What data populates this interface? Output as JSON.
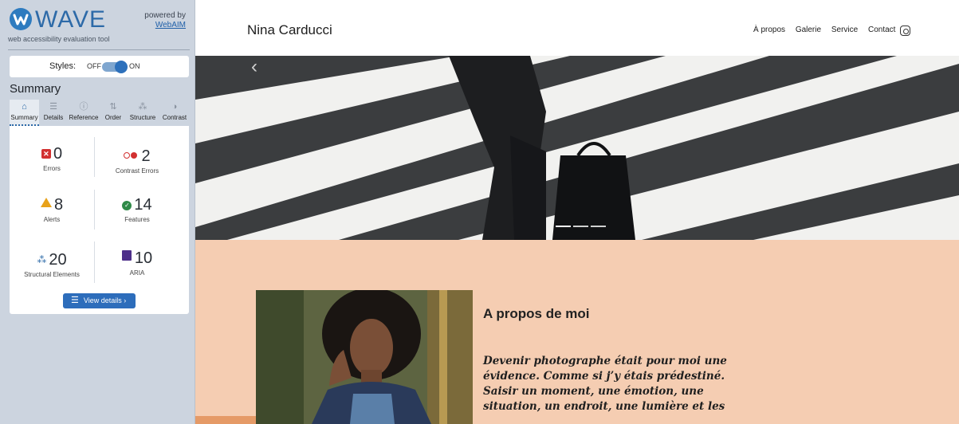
{
  "wave": {
    "logo_text": "WAVE",
    "subtitle": "web accessibility evaluation tool",
    "powered_by": "powered by",
    "webaim_link": "WebAIM",
    "styles": {
      "label": "Styles:",
      "off": "OFF",
      "on": "ON",
      "state": "on"
    },
    "summary_title": "Summary",
    "tabs": [
      {
        "label": "Summary",
        "icon": "home-icon",
        "glyph": "⌂"
      },
      {
        "label": "Details",
        "icon": "list-icon",
        "glyph": "☰"
      },
      {
        "label": "Reference",
        "icon": "info-icon",
        "glyph": "ⓘ"
      },
      {
        "label": "Order",
        "icon": "order-icon",
        "glyph": "⇅"
      },
      {
        "label": "Structure",
        "icon": "structure-icon",
        "glyph": "⁂"
      },
      {
        "label": "Contrast",
        "icon": "contrast-icon",
        "glyph": "◑"
      }
    ],
    "stats": {
      "errors": {
        "count": "0",
        "label": "Errors",
        "color": "#d23030"
      },
      "contrast": {
        "count": "2",
        "label": "Contrast Errors",
        "color": "#d23030"
      },
      "alerts": {
        "count": "8",
        "label": "Alerts",
        "color": "#e8a21a"
      },
      "features": {
        "count": "14",
        "label": "Features",
        "color": "#2f8a48"
      },
      "structural": {
        "count": "20",
        "label": "Structural Elements",
        "color": "#2d6aa8"
      },
      "aria": {
        "count": "10",
        "label": "ARIA",
        "color": "#4d2f8a"
      }
    },
    "details_button": "View details ›"
  },
  "site": {
    "brand": "Nina Carducci",
    "nav": [
      "À propos",
      "Galerie",
      "Service",
      "Contact"
    ],
    "carousel": {
      "slides": 3,
      "active": 1
    },
    "about": {
      "title": "A propos de moi",
      "text": "Devenir photographe était pour moi une évidence. Comme si j’y étais prédestiné. Saisir un moment, une émotion, une situation, un endroit, une lumière et les"
    },
    "colors": {
      "about_bg": "#f5cdb2",
      "accent": "#e59a67"
    }
  }
}
